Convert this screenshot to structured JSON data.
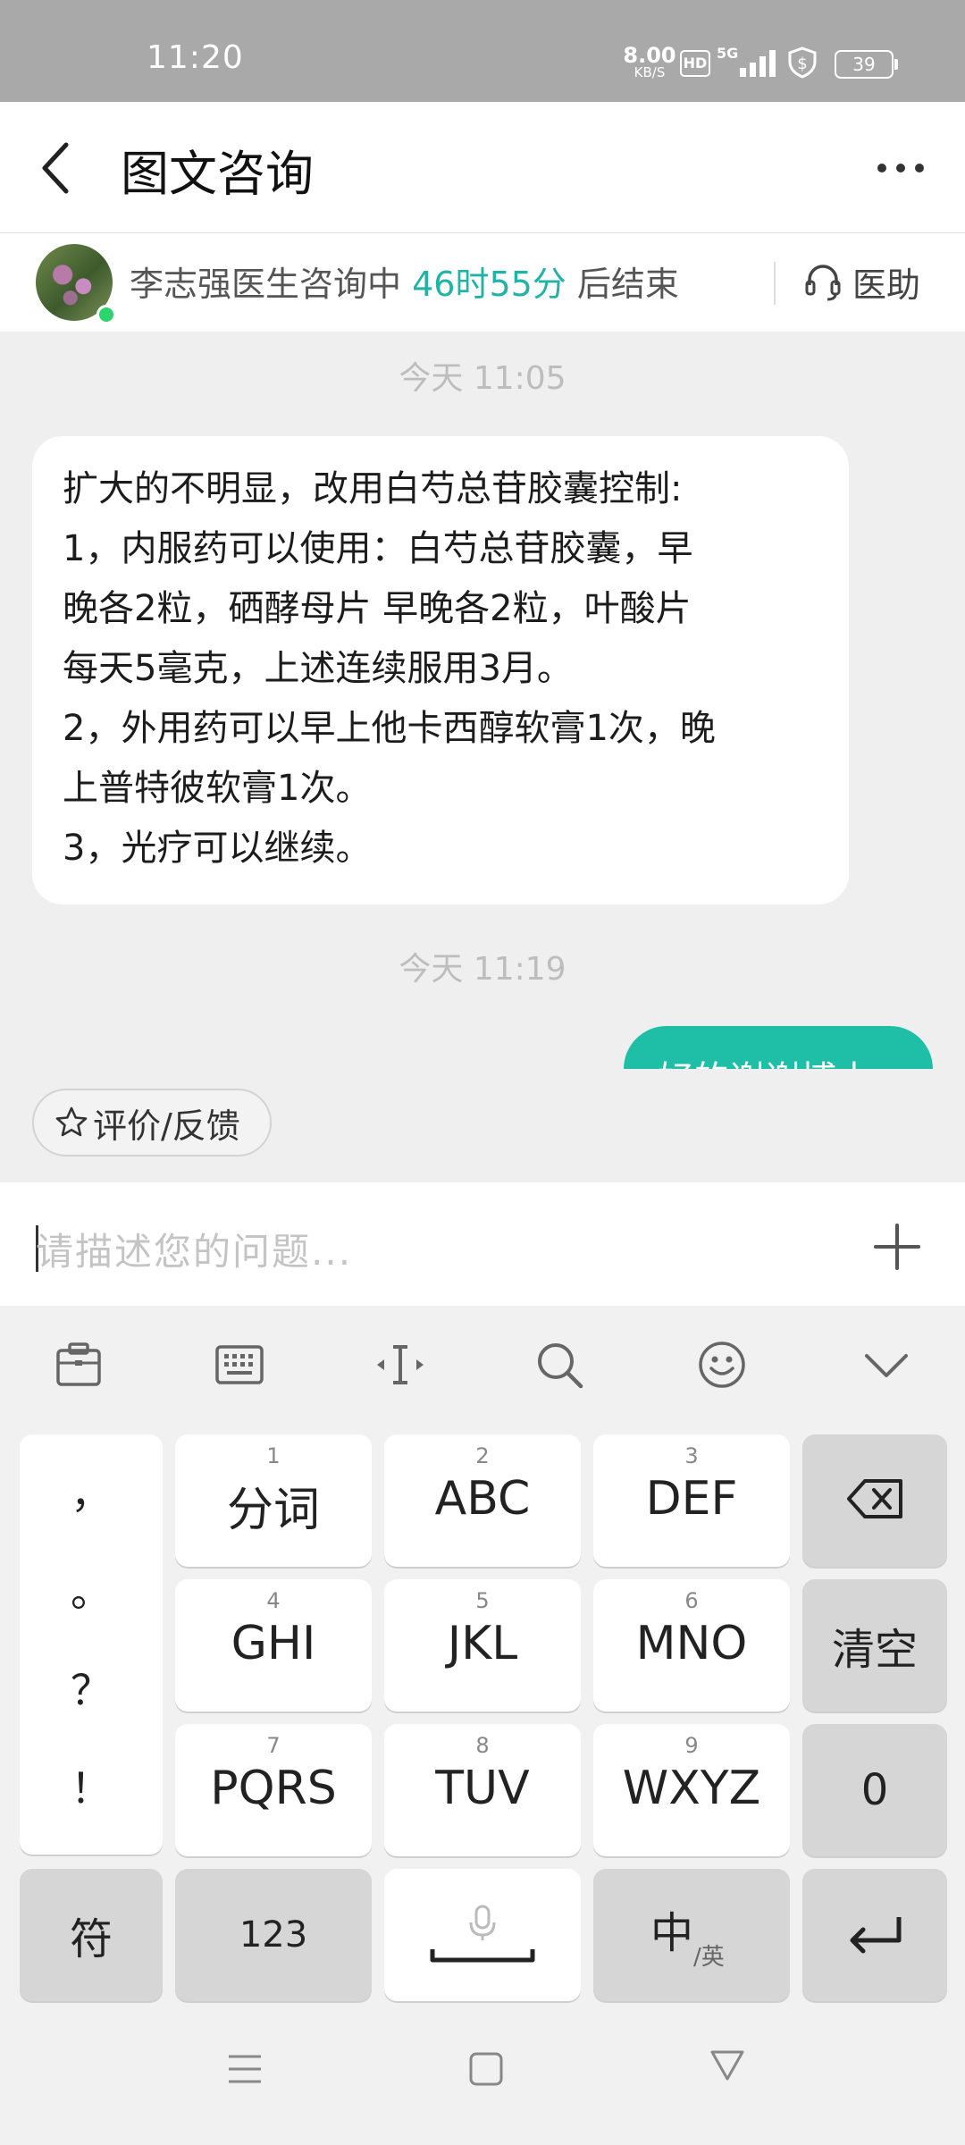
{
  "status_bar": {
    "time": "11:20",
    "net_speed": "8.00",
    "net_speed_unit": "KB/S",
    "hd": "HD",
    "network": "5G",
    "battery": "39"
  },
  "header": {
    "title": "图文咨询"
  },
  "doctor_bar": {
    "prefix": "李志强医生咨询中 ",
    "timer": "46时55分",
    "suffix": " 后结束",
    "assistant_label": "医助"
  },
  "chat": {
    "timestamp_1": "今天 11:05",
    "timestamp_2": "今天 11:19",
    "message_lines": [
      "扩大的不明显，改用白芍总苷胶囊控制:",
      "1，内服药可以使用：白芍总苷胶囊，早",
      "晚各2粒，硒酵母片 早晚各2粒，叶酸片",
      "每天5毫克，上述连续服用3月。",
      "2，外用药可以早上他卡西醇软膏1次，晚",
      "上普特彼软膏1次。",
      "3，光疗可以继续。"
    ],
    "reply_partial": "好的谢谢博士"
  },
  "feedback_label": "评价/反馈",
  "input": {
    "placeholder": "请描述您的问题..."
  },
  "keyboard": {
    "punctuation": [
      "，",
      "。",
      "？",
      "！"
    ],
    "keys": [
      {
        "num": "1",
        "label": "分词"
      },
      {
        "num": "2",
        "label": "ABC"
      },
      {
        "num": "3",
        "label": "DEF"
      },
      {
        "num": "4",
        "label": "GHI"
      },
      {
        "num": "5",
        "label": "JKL"
      },
      {
        "num": "6",
        "label": "MNO"
      },
      {
        "num": "7",
        "label": "PQRS"
      },
      {
        "num": "8",
        "label": "TUV"
      },
      {
        "num": "9",
        "label": "WXYZ"
      }
    ],
    "clear_label": "清空",
    "zero_label": "0",
    "symbol_label": "符",
    "num_label": "123",
    "lang_main": "中",
    "lang_sub": "/英"
  },
  "colors": {
    "accent": "#1fbfa7",
    "timer": "#23b3a4",
    "status_bar": "#a9a9a9"
  }
}
